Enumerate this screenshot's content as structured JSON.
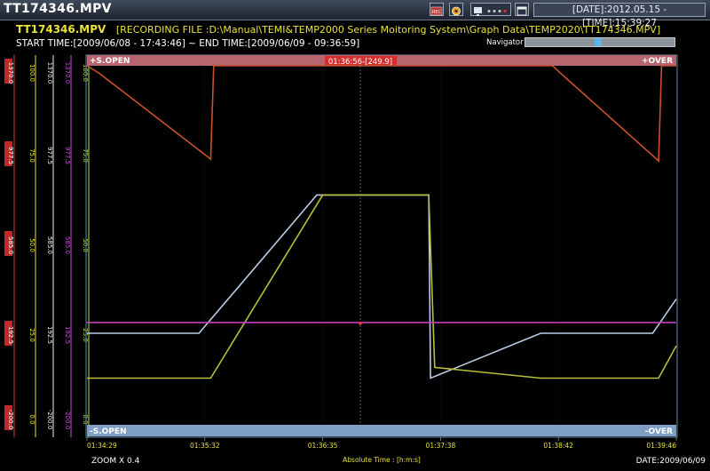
{
  "window": {
    "title": "TT174346.MPV",
    "date_time": "[DATE]:2012.05.15 - [TIME]:15:39:27"
  },
  "info": {
    "file_name": "TT174346.MPV",
    "recording_file": "[RECORDING FILE :D:\\Manual\\TEMI&TEMP2000 Series Moitoring System\\Graph Data\\TEMP2020\\TT174346.MPV]",
    "time_range": "START TIME:[2009/06/08 - 17:43:46] ~ END TIME:[2009/06/09 - 09:36:59]",
    "navigator_label": "Navigator :",
    "navigator_position": 0.49
  },
  "toolbar": {
    "icons": [
      "rec-icon",
      "gear-icon",
      "monitor-icon",
      "window-icon"
    ]
  },
  "plot": {
    "top_left_label": "+S.OPEN",
    "top_right_label": "+OVER",
    "bottom_left_label": "-S.OPEN",
    "bottom_right_label": "-OVER",
    "cursor_readout": "01:36:56-[249.9]",
    "x_ticks": [
      "01:34:29",
      "01:35:32",
      "01:36:35",
      "01:37:38",
      "01:38:42",
      "01:39:46"
    ],
    "x_axis_label": "Absolute Time : [h:m:s]",
    "zoom": "ZOOM X 0.4",
    "date": "DATE:2009/06/09"
  },
  "axes": [
    {
      "color": "#d83a3a",
      "ticks": [
        "1370.0",
        "977.5",
        "585.0",
        "192.5",
        "-200.0"
      ],
      "highlight": true
    },
    {
      "color": "#e8e23a",
      "ticks": [
        "100.0",
        "75.0",
        "50.0",
        "25.0",
        "0.0"
      ]
    },
    {
      "color": "#f0f0f0",
      "ticks": [
        "1370.0",
        "977.5",
        "585.0",
        "192.5",
        "-200.0"
      ]
    },
    {
      "color": "#c050d0",
      "ticks": [
        "1370.0",
        "977.5",
        "585.0",
        "192.5",
        "-200.0"
      ]
    },
    {
      "color": "#bfe04a",
      "ticks": [
        "100.0",
        "75.0",
        "50.0",
        "25.0",
        "0.0"
      ]
    }
  ],
  "chart_data": {
    "type": "line",
    "x_ticks": [
      "01:34:29",
      "01:35:32",
      "01:36:35",
      "01:37:38",
      "01:38:42",
      "01:39:46"
    ],
    "ylim": [
      0,
      100
    ],
    "xlabel": "Absolute Time : [h:m:s]",
    "series": [
      {
        "color": "#c8502a",
        "points": [
          [
            0,
            100
          ],
          [
            0.02,
            98
          ],
          [
            0.21,
            74
          ],
          [
            0.215,
            100
          ],
          [
            0.79,
            100
          ],
          [
            0.81,
            97
          ],
          [
            0.97,
            73.5
          ],
          [
            0.975,
            100
          ],
          [
            1,
            100
          ]
        ]
      },
      {
        "color": "#b9cde6",
        "points": [
          [
            0,
            25.5
          ],
          [
            0.19,
            25.5
          ],
          [
            0.39,
            64
          ],
          [
            0.58,
            64
          ],
          [
            0.583,
            13
          ],
          [
            0.77,
            25.5
          ],
          [
            0.96,
            25.5
          ],
          [
            1,
            35
          ]
        ]
      },
      {
        "color": "#b8bf3a",
        "points": [
          [
            0,
            13
          ],
          [
            0.21,
            13
          ],
          [
            0.4,
            64
          ],
          [
            0.58,
            64
          ],
          [
            0.59,
            16
          ],
          [
            0.77,
            13
          ],
          [
            0.97,
            13
          ],
          [
            1,
            22
          ]
        ]
      },
      {
        "color": "#c040c0",
        "points": [
          [
            0,
            28.5
          ],
          [
            1,
            28.5
          ]
        ]
      }
    ]
  }
}
